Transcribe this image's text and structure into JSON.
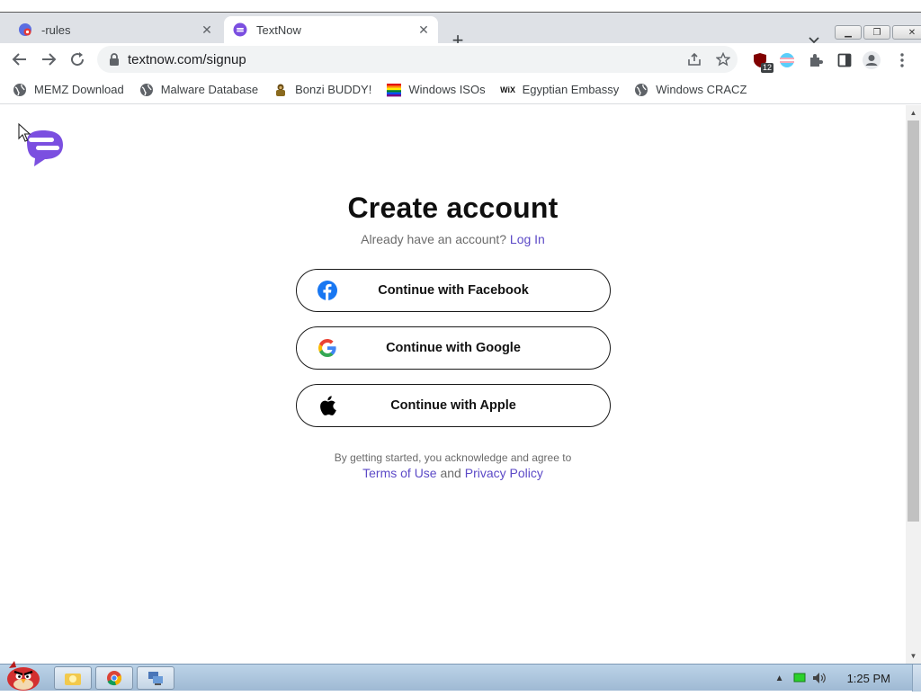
{
  "browser": {
    "tabs": [
      {
        "title": "⁠-rules",
        "active": false
      },
      {
        "title": "TextNow",
        "active": true
      }
    ],
    "url": "textnow.com/signup",
    "extension_badge": "12",
    "bookmarks": [
      {
        "label": "MEMZ Download",
        "icon": "globe-icon"
      },
      {
        "label": "Malware Database",
        "icon": "globe-icon"
      },
      {
        "label": "Bonzi BUDDY!",
        "icon": "bonzi-icon"
      },
      {
        "label": "Windows ISOs",
        "icon": "rainbow-flag-icon"
      },
      {
        "label": "Egyptian Embassy",
        "icon": "wix-icon"
      },
      {
        "label": "Windows CRACZ",
        "icon": "globe-icon"
      }
    ]
  },
  "page": {
    "heading": "Create account",
    "already_text": "Already have an account?",
    "login_link": "Log In",
    "buttons": {
      "facebook": "Continue with Facebook",
      "google": "Continue with Google",
      "apple": "Continue with Apple"
    },
    "legal_line1": "By getting started, you acknowledge and agree to",
    "terms_link": "Terms of Use",
    "and_text": "and",
    "privacy_link": "Privacy Policy"
  },
  "taskbar": {
    "clock": "1:25 PM"
  },
  "colors": {
    "brand_purple": "#7b4fe0",
    "link_purple": "#5c4ac7",
    "facebook_blue": "#1877f2"
  }
}
